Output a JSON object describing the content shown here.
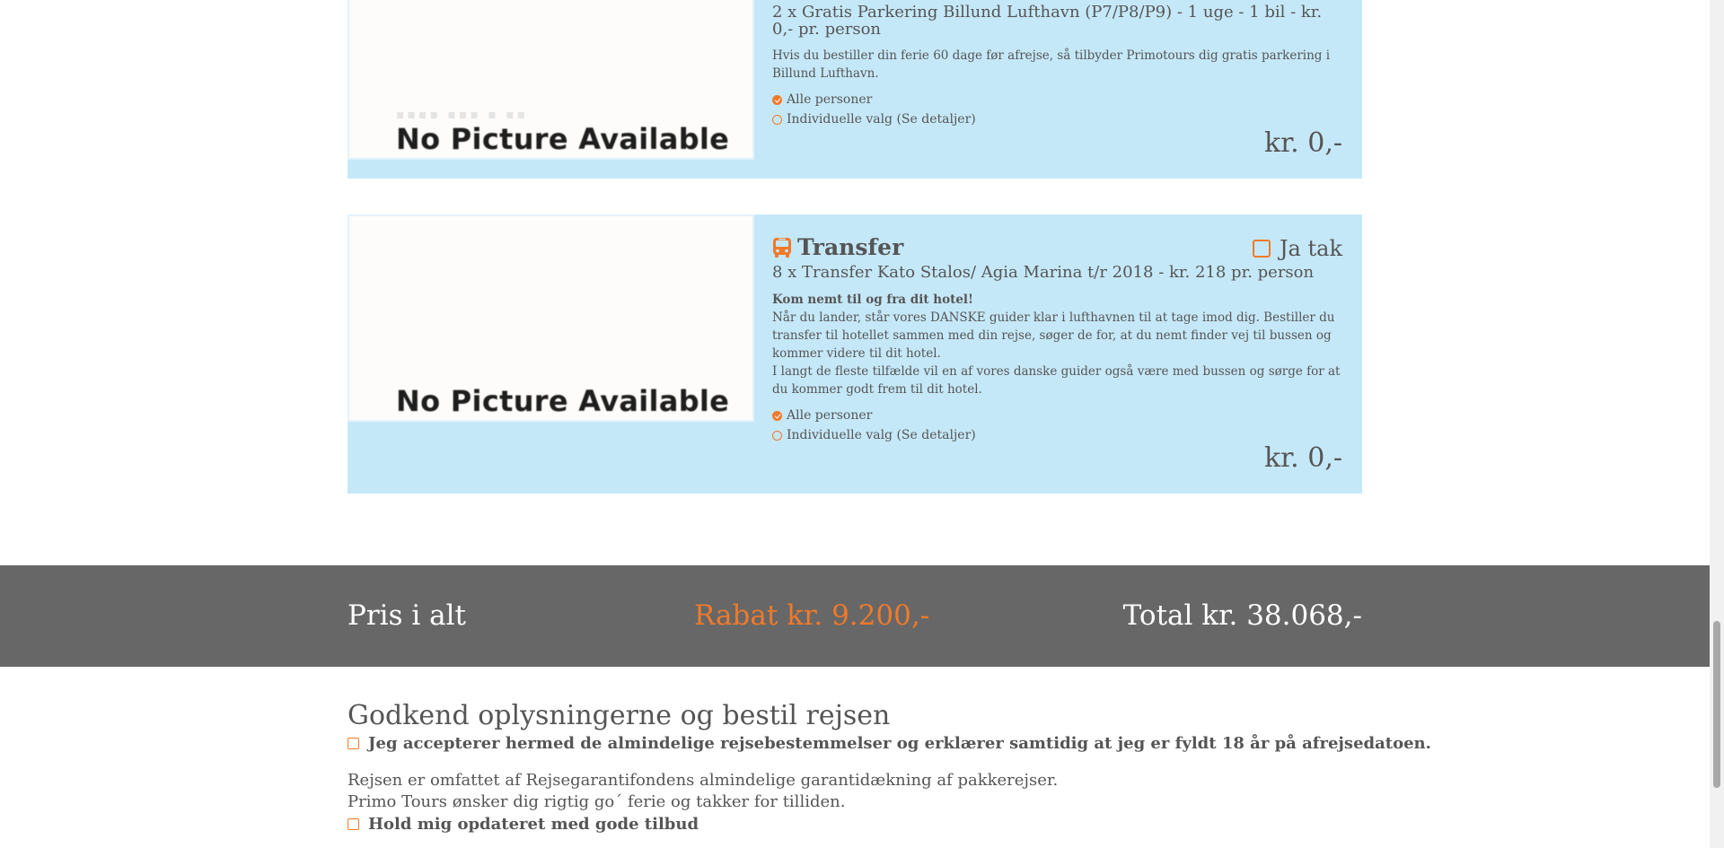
{
  "cards": [
    {
      "image_text": "No Picture Available",
      "subtitle": "2 x Gratis Parkering Billund Lufthavn (P7/P8/P9) - 1 uge - 1 bil - kr. 0,- pr. person",
      "description": "Hvis du bestiller din ferie 60 dage før afrejse, så tilbyder Primotours dig gratis parkering i Billund Lufthavn.",
      "option_all": "Alle personer",
      "option_individual": "Individuelle valg (Se detaljer)",
      "price": "kr. 0,-"
    },
    {
      "image_text": "No Picture Available",
      "title": "Transfer",
      "title_icon": "bus-icon",
      "accept_label": "Ja tak",
      "subtitle": "8 x Transfer Kato Stalos/ Agia Marina t/r 2018 - kr. 218 pr. person",
      "description_heading": "Kom nemt til og fra dit hotel!",
      "description_1": "Når du lander, står vores DANSKE guider klar i lufthavnen til at tage imod dig. Bestiller du transfer til hotellet sammen med din rejse, søger de for, at du nemt finder vej til bussen og kommer videre til dit hotel.",
      "description_2": "I langt de fleste tilfælde vil en af vores danske guider også være med bussen og sørge for at du kommer godt frem til dit hotel.",
      "option_all": "Alle personer",
      "option_individual": "Individuelle valg (Se detaljer)",
      "price": "kr. 0,-"
    }
  ],
  "summary": {
    "label": "Pris i alt",
    "discount": "Rabat kr. 9.200,-",
    "total": "Total kr. 38.068,-"
  },
  "confirm": {
    "title": "Godkend oplysningerne og bestil rejsen",
    "terms_label": "Jeg accepterer hermed de almindelige rejsebestemmelser og erklærer samtidig at jeg er fyldt 18 år på afrejsedatoen.",
    "guarantee_text": "Rejsen er omfattet af Rejsegarantifondens almindelige garantidækning af pakkerejser.",
    "thanks_text": "Primo Tours ønsker dig rigtig go´ ferie og takker for tilliden.",
    "newsletter_label": "Hold mig opdateret med gode tilbud"
  },
  "colors": {
    "accent": "#f07a2a",
    "card_bg": "#c5e8f8",
    "summary_bg": "#676767"
  }
}
